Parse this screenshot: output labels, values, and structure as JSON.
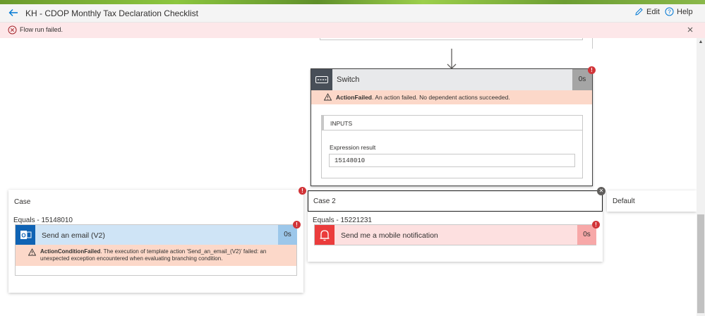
{
  "header": {
    "title": "KH - CDOP Monthly Tax Declaration Checklist",
    "edit_label": "Edit",
    "help_label": "Help"
  },
  "banner": {
    "message": "Flow run failed."
  },
  "switch": {
    "title": "Switch",
    "duration": "0s",
    "error_code": "ActionFailed",
    "error_message": ". An action failed. No dependent actions succeeded.",
    "inputs_label": "INPUTS",
    "expression_label": "Expression result",
    "expression_value": "15148010"
  },
  "cases": [
    {
      "label": "Case",
      "equals": "Equals - 15148010",
      "action": {
        "title": "Send an email (V2)",
        "duration": "0s",
        "error_code": "ActionConditionFailed",
        "error_message": ". The execution of template action 'Send_an_email_(V2)' failed: an unexpected exception encountered when evaluating branching condition."
      }
    },
    {
      "label": "Case 2",
      "equals": "Equals - 15221231",
      "action": {
        "title": "Send me a mobile notification",
        "duration": "0s"
      }
    },
    {
      "label": "Default"
    }
  ],
  "colors": {
    "accent": "#0078d4",
    "error": "#d13438",
    "error_bg": "#fde7e9",
    "action_error_bg": "#fcd8c9"
  },
  "icons": {
    "back": "arrow-left-icon",
    "edit": "pencil-icon",
    "help": "help-circle-icon",
    "error": "error-circle-icon",
    "warning": "warning-triangle-icon",
    "switch": "switch-icon",
    "outlook": "outlook-icon",
    "notification": "bell-icon"
  }
}
